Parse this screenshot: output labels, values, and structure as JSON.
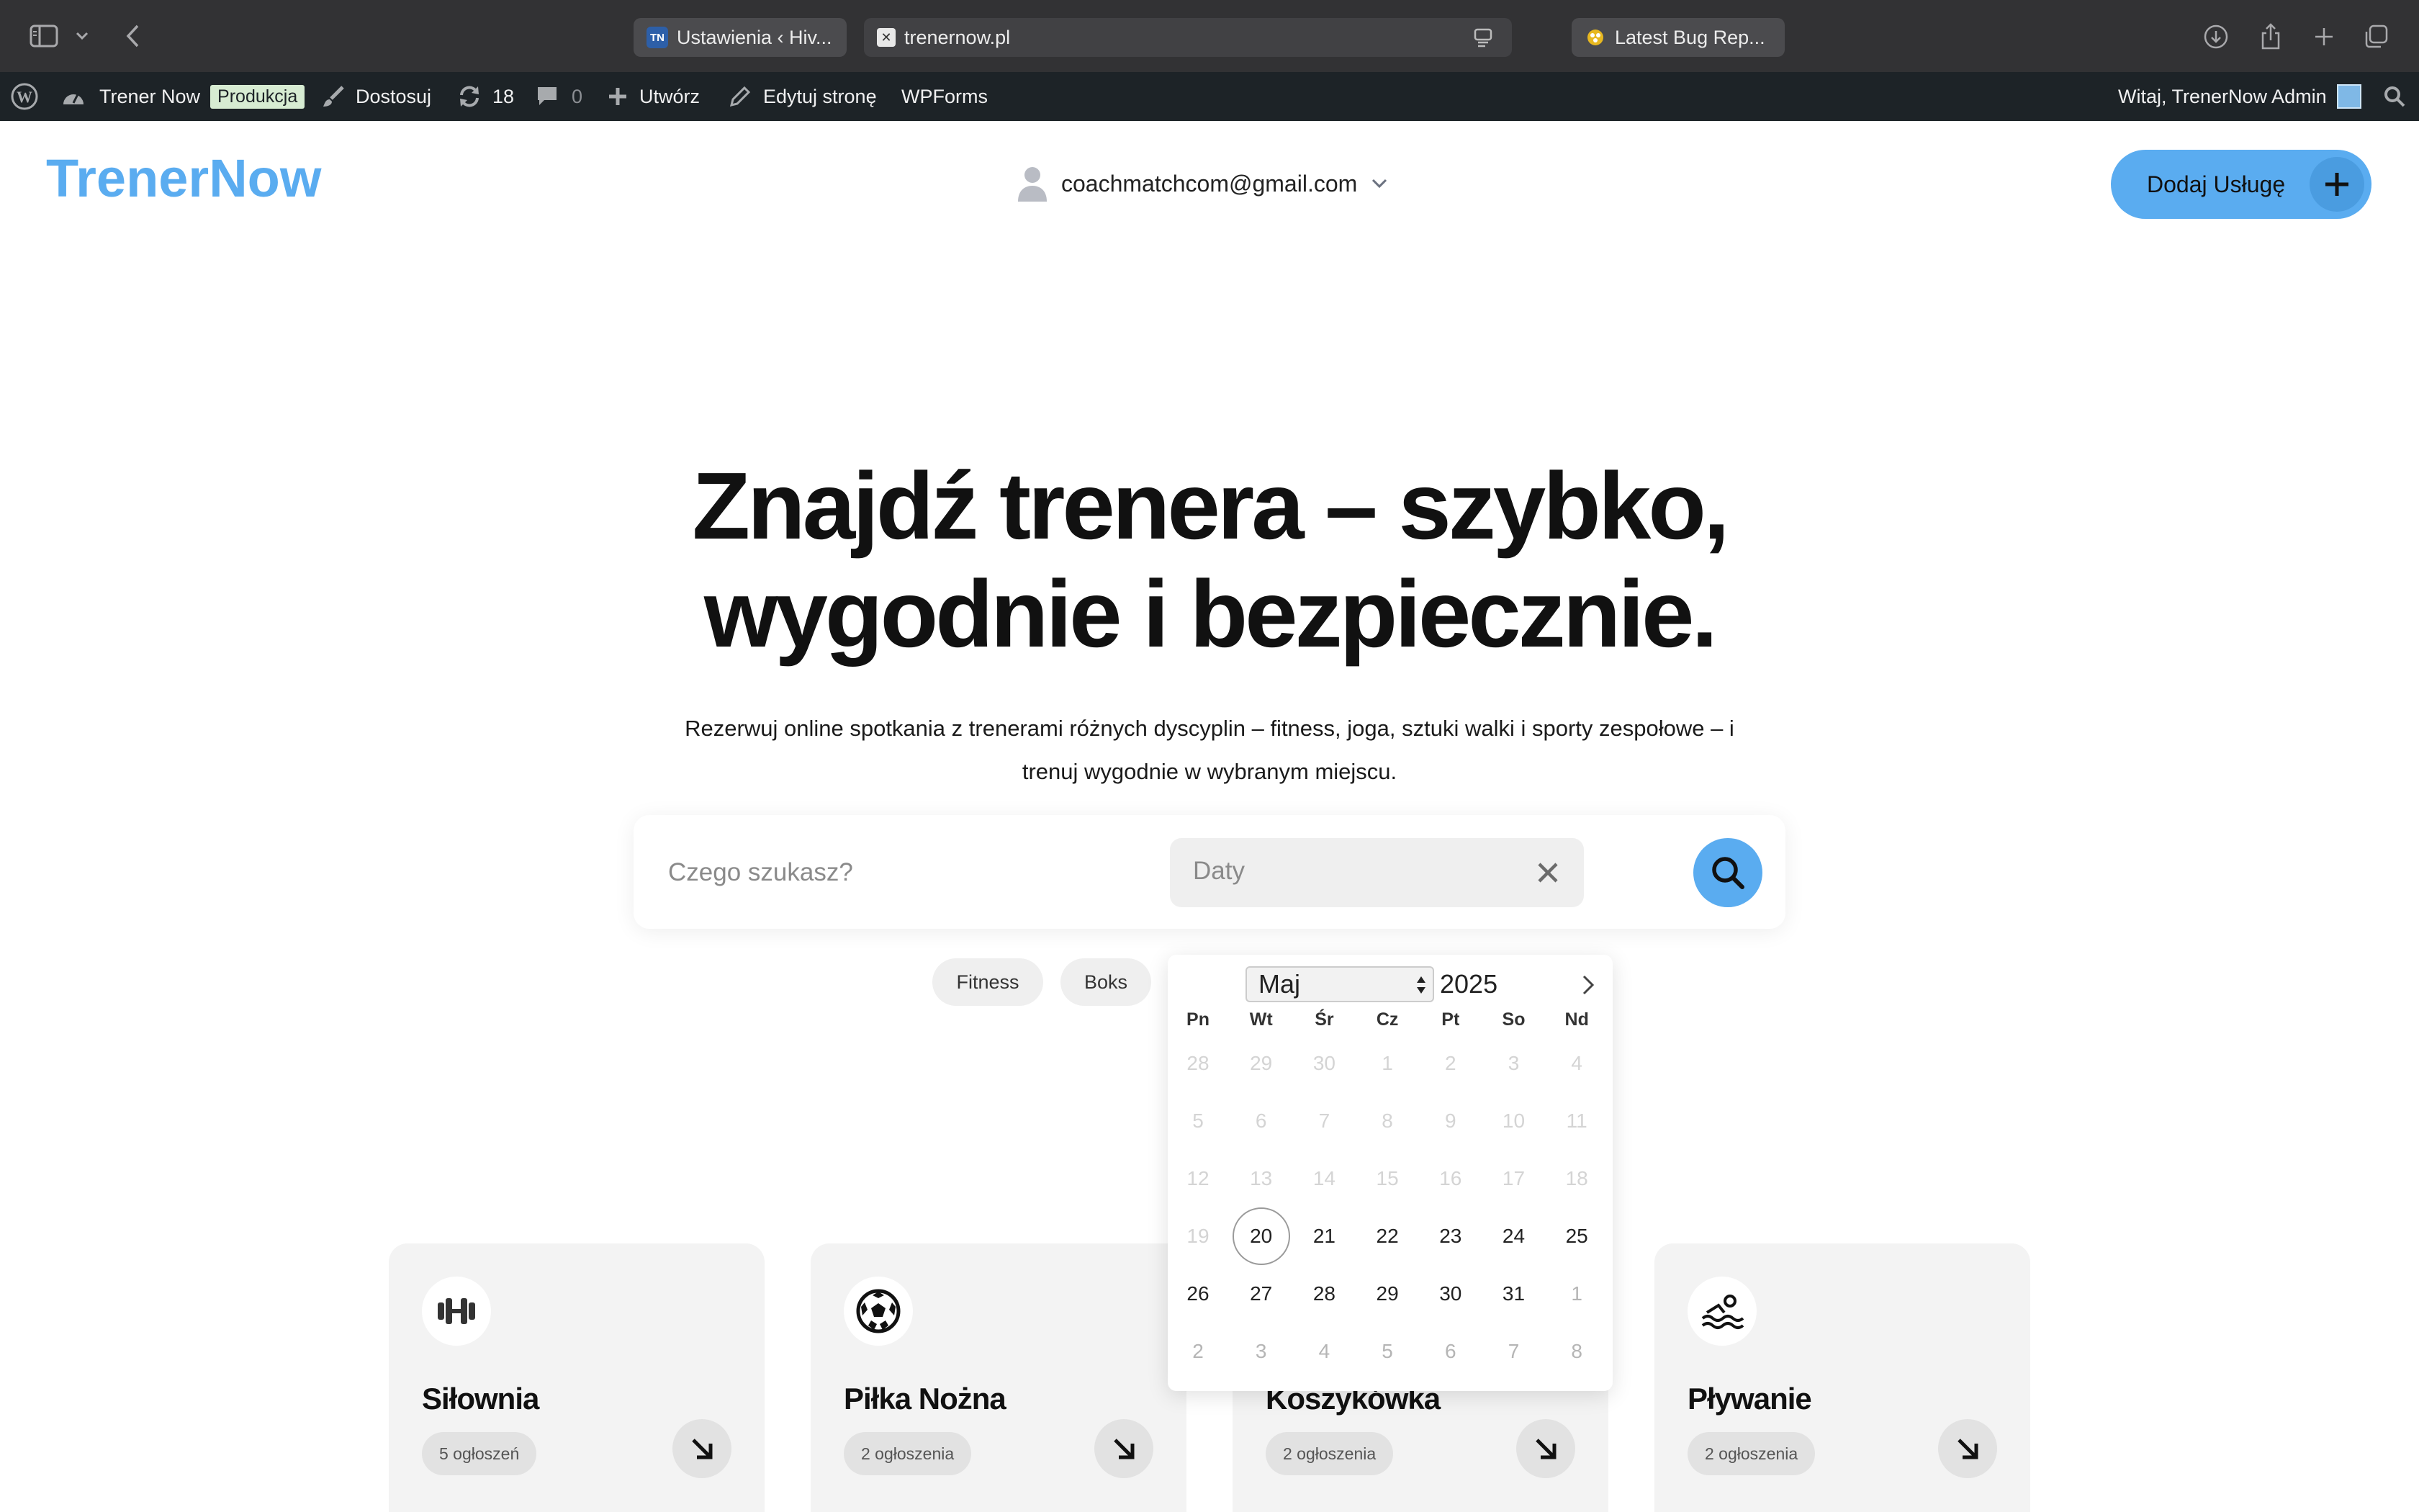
{
  "browser": {
    "tabs": [
      {
        "favicon": "TN",
        "label": "Ustawienia ‹ Hiv..."
      },
      {
        "favicon": "x",
        "label": "trenernow.pl"
      },
      {
        "favicon": "bug",
        "label": "Latest Bug Rep..."
      }
    ],
    "icons": [
      "sidebar-icon",
      "chevron-down-icon",
      "back-icon",
      "reader-icon",
      "download-icon",
      "share-icon",
      "new-tab-icon",
      "tab-overview-icon"
    ]
  },
  "admin_bar": {
    "site_name": "Trener Now",
    "env_badge": "Produkcja",
    "customize": "Dostosuj",
    "updates_count": "18",
    "comments_count": "0",
    "new": "Utwórz",
    "edit_page": "Edytuj stronę",
    "wpforms": "WPForms",
    "greeting": "Witaj, TrenerNow Admin"
  },
  "header": {
    "logo": "TrenerNow",
    "user_email": "coachmatchcom@gmail.com",
    "add_service": "Dodaj Usługę"
  },
  "hero": {
    "title_line1": "Znajdź trenera – szybko,",
    "title_line2": "wygodnie i bezpiecznie.",
    "subtitle_line1": "Rezerwuj online spotkania z trenerami różnych dyscyplin – fitness, joga, sztuki walki i sporty zespołowe – i",
    "subtitle_line2": "trenuj wygodnie w wybranym miejscu."
  },
  "search": {
    "query_placeholder": "Czego szukasz?",
    "dates_placeholder": "Daty",
    "chips": [
      "Fitness",
      "Boks"
    ]
  },
  "calendar": {
    "month": "Maj",
    "year": "2025",
    "weekdays": [
      "Pn",
      "Wt",
      "Śr",
      "Cz",
      "Pt",
      "So",
      "Nd"
    ],
    "weeks": [
      [
        "28",
        "29",
        "30",
        "1",
        "2",
        "3",
        "4"
      ],
      [
        "5",
        "6",
        "7",
        "8",
        "9",
        "10",
        "11"
      ],
      [
        "12",
        "13",
        "14",
        "15",
        "16",
        "17",
        "18"
      ],
      [
        "19",
        "20",
        "21",
        "22",
        "23",
        "24",
        "25"
      ],
      [
        "26",
        "27",
        "28",
        "29",
        "30",
        "31",
        "1"
      ],
      [
        "2",
        "3",
        "4",
        "5",
        "6",
        "7",
        "8"
      ]
    ],
    "today": "20"
  },
  "categories": [
    {
      "name": "Siłownia",
      "count": "5 ogłoszeń",
      "icon": "dumbbell-icon"
    },
    {
      "name": "Piłka Nożna",
      "count": "2 ogłoszenia",
      "icon": "soccer-ball-icon"
    },
    {
      "name": "Koszykówka",
      "count": "2 ogłoszenia",
      "icon": "basketball-icon"
    },
    {
      "name": "Pływanie",
      "count": "2 ogłoszenia",
      "icon": "swimming-icon"
    }
  ],
  "colors": {
    "accent": "#5aacf0",
    "chrome": "#323234",
    "admin_bar": "#1d2327",
    "card": "#f3f3f3"
  }
}
